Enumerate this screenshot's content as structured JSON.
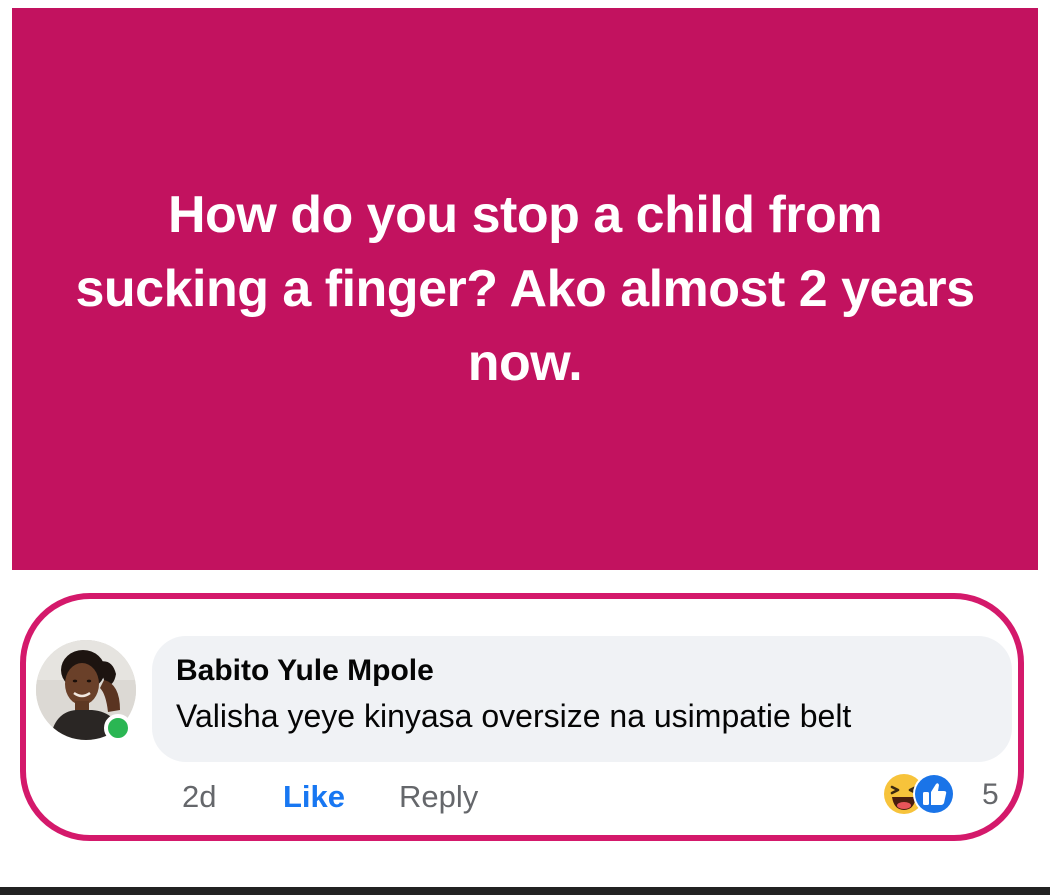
{
  "post": {
    "text": "How do you stop a child from sucking a finger? Ako almost 2 years now.",
    "background_color": "#c2125f"
  },
  "comment": {
    "author": "Babito Yule Mpole",
    "text": "Valisha yeye kinyasa oversize na usimpatie belt",
    "timestamp": "2d",
    "like_label": "Like",
    "reply_label": "Reply",
    "reactions": {
      "icons": [
        "haha-icon",
        "like-icon"
      ],
      "count": "5"
    },
    "avatar": "profile-photo",
    "online": true
  },
  "highlight_color": "#d4196b"
}
